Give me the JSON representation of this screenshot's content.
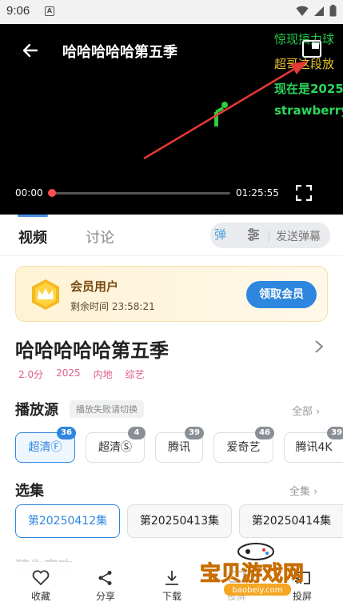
{
  "status_bar": {
    "time": "9:06",
    "notification_icon": "A"
  },
  "player": {
    "title": "哈哈哈哈哈第五季",
    "danmaku": [
      "惊现搞力球",
      "超哥这段放",
      "现在是2025",
      "strawberry"
    ],
    "current_time": "00:00",
    "duration": "01:25:55",
    "progress": 0,
    "annotation_color": "#e53935"
  },
  "tabs": {
    "video": "视频",
    "discussion": "讨论"
  },
  "danmaku_bar": {
    "toggle_label": "弹",
    "send_label": "发送弹幕"
  },
  "vip": {
    "title": "会员用户",
    "remaining": "剩余时间 23:58:21",
    "button": "领取会员"
  },
  "show": {
    "title": "哈哈哈哈哈第五季",
    "tags": [
      "2.0分",
      "2025",
      "内地",
      "综艺"
    ]
  },
  "sources": {
    "title": "播放源",
    "hint": "播放失败请切换",
    "more": "全部",
    "items": [
      {
        "label": "超清Ⓕ",
        "count": "36"
      },
      {
        "label": "超清Ⓢ",
        "count": "4"
      },
      {
        "label": "腾讯",
        "count": "39"
      },
      {
        "label": "爱奇艺",
        "count": "46"
      },
      {
        "label": "腾讯4K",
        "count": "39"
      }
    ]
  },
  "episodes": {
    "title": "选集",
    "more": "全集",
    "items": [
      "第20250412集",
      "第20250413集",
      "第20250414集"
    ]
  },
  "recommend_title": "猜你喜欢",
  "bottom_bar": {
    "favorite": "收藏",
    "share": "分享",
    "download": "下载",
    "cast": "投屏",
    "cast_faded": "投屏"
  },
  "watermark": {
    "text": "宝贝游戏网",
    "url": "baobeiy.com"
  },
  "colors": {
    "accent": "#2e86de",
    "tag": "#e05c8a",
    "vip_text": "#7a4b12"
  }
}
